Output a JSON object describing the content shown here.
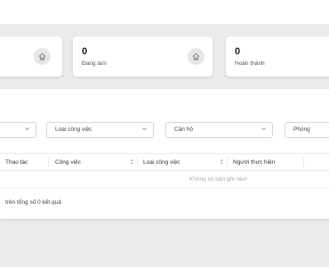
{
  "stats": [
    {
      "value": "0",
      "label": "Đang làm",
      "icon": "home-icon"
    },
    {
      "value": "0",
      "label": "Hoàn thành",
      "icon": "home-icon"
    }
  ],
  "filters": {
    "work_type": "Loại công việc",
    "apartment": "Căn hộ",
    "room": "Phòng"
  },
  "table": {
    "columns": [
      "Thao tác",
      "Công việc",
      "Loại công việc",
      "Người thực hiện"
    ],
    "empty_text": "Không có bản ghi nào!"
  },
  "summary": "trên tổng số 0 kết quả",
  "colors": {
    "background": "#ebebeb",
    "card": "#ffffff",
    "icon_bg": "#e6e6e6"
  }
}
